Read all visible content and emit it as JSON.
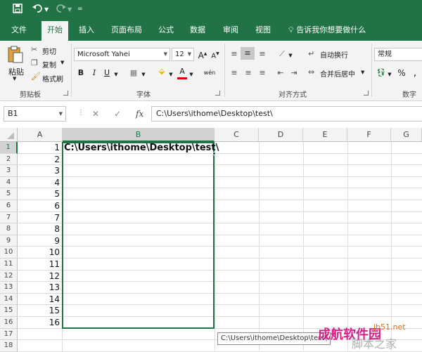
{
  "quick_access": {
    "save_icon": "save-icon",
    "undo_icon": "undo-icon",
    "redo_icon": "redo-icon",
    "customize_icon": "customize-icon"
  },
  "tabs": [
    "文件",
    "开始",
    "插入",
    "页面布局",
    "公式",
    "数据",
    "审阅",
    "视图"
  ],
  "tell_me": "告诉我你想要做什么",
  "ribbon": {
    "clipboard": {
      "label": "剪贴板",
      "paste": "粘贴",
      "cut": "剪切",
      "copy": "复制",
      "format_painter": "格式刷"
    },
    "font": {
      "label": "字体",
      "font_name": "Microsoft Yahei",
      "font_size": "12",
      "bold": "B",
      "italic": "I",
      "underline": "U",
      "wen": "wén"
    },
    "alignment": {
      "label": "对齐方式",
      "wrap_text": "自动换行",
      "merge_center": "合并后居中"
    },
    "number": {
      "label": "数字",
      "format": "常规",
      "percent": "%"
    }
  },
  "formula_bar": {
    "name_box": "B1",
    "cancel": "✕",
    "enter": "✓",
    "fx": "fx",
    "value": "C:\\Users\\ithome\\Desktop\\test\\"
  },
  "columns": [
    "A",
    "B",
    "C",
    "D",
    "E",
    "F",
    "G"
  ],
  "rows": [
    "1",
    "2",
    "3",
    "4",
    "5",
    "6",
    "7",
    "8",
    "9",
    "10",
    "11",
    "12",
    "13",
    "14",
    "15",
    "16",
    "17",
    "18"
  ],
  "col_a_values": [
    "1",
    "2",
    "3",
    "4",
    "5",
    "6",
    "7",
    "8",
    "9",
    "10",
    "11",
    "12",
    "13",
    "14",
    "15",
    "16"
  ],
  "cell_b1": "C:\\Users\\ithome\\Desktop\\test\\",
  "tooltip": "C:\\Users\\ithome\\Desktop\\test\\",
  "watermark": {
    "line1": "成航软件园",
    "site": "jb51.net",
    "line2": "脚本之家"
  },
  "colors": {
    "accent": "#217346"
  }
}
